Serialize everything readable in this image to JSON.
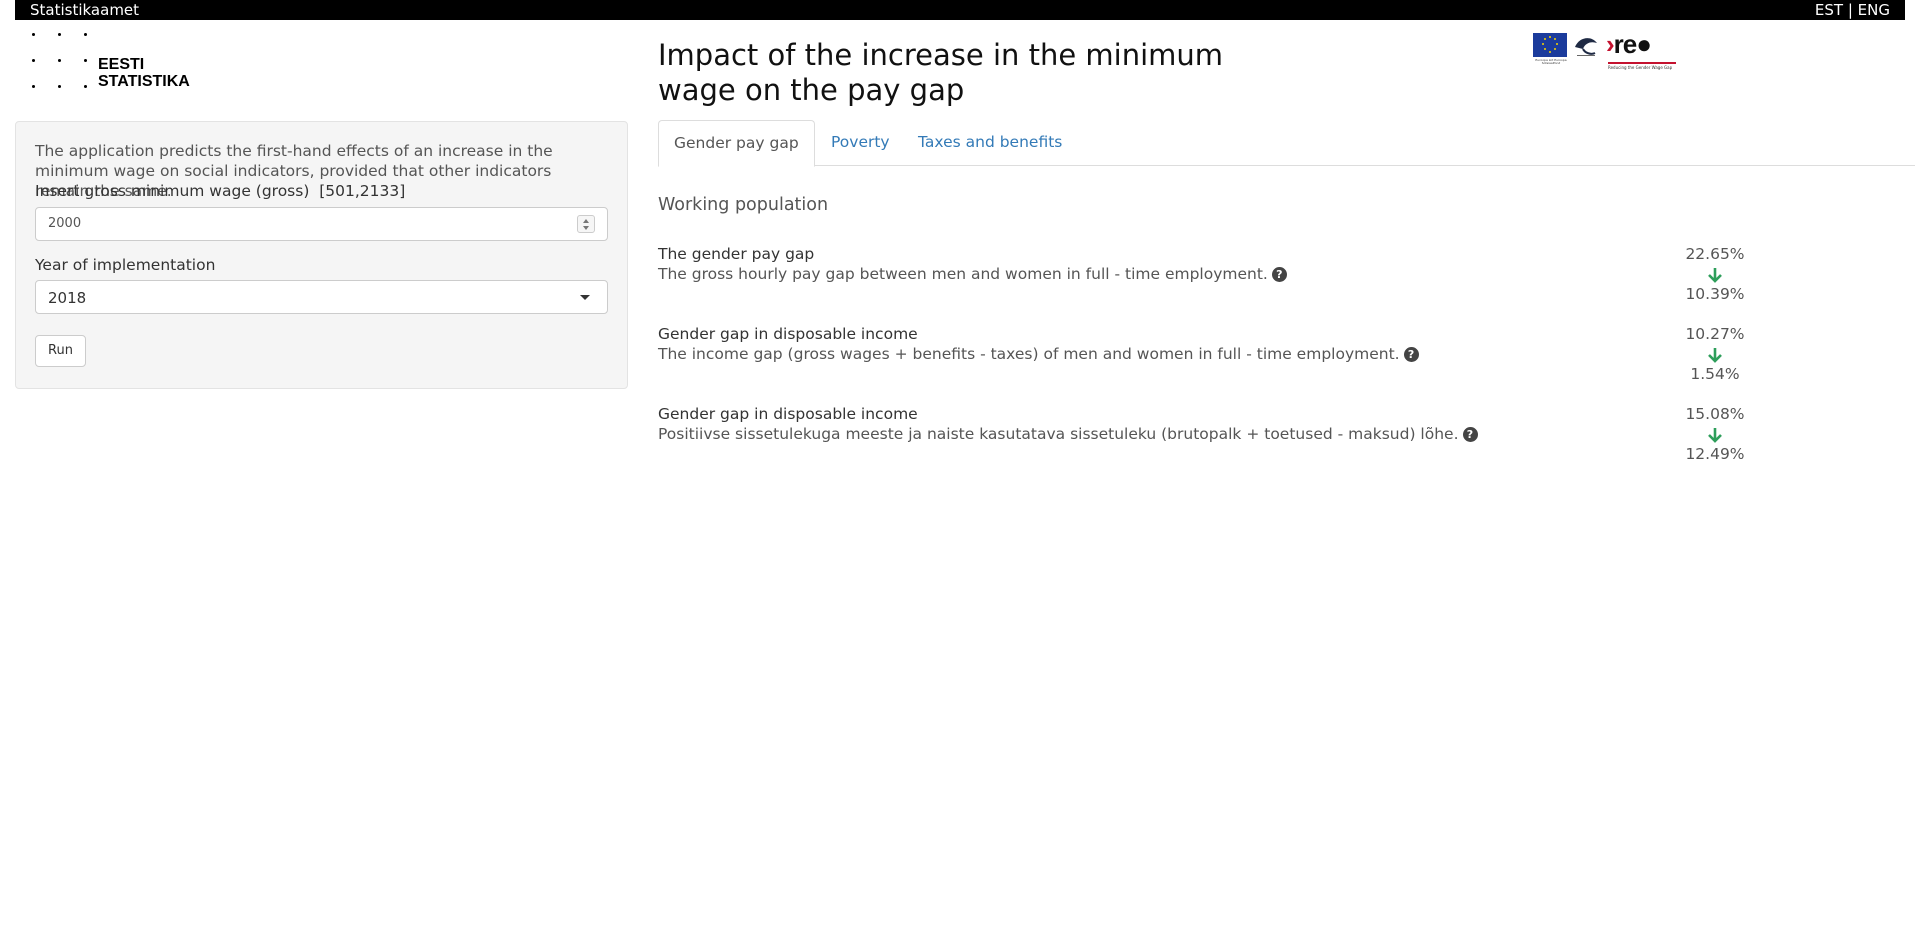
{
  "topbar": {
    "org_name": "Statistikaamet",
    "lang_est": "EST",
    "lang_sep": "|",
    "lang_eng": "ENG"
  },
  "logo": {
    "line1": "EESTI",
    "line2": "STATISTIKA"
  },
  "sidebar": {
    "description": "The application predicts the first-hand effects of an increase in the minimum wage on social indicators, provided that other indicators remain the same.",
    "wage_label": "Insert gross minimum wage (gross)  [501,2133]",
    "wage_value": "2000",
    "year_label": "Year of implementation",
    "year_value": "2018",
    "run_label": "Run"
  },
  "main": {
    "title": "Impact of the increase in the minimum wage on the pay gap",
    "partner_logos": {
      "eu_text": "Euroopa Liit Euroopa Sotsiaalfond",
      "reke_mark": "re",
      "reke_caption": "Reducing the Gender Wage Gap"
    },
    "tabs": [
      {
        "label": "Gender pay gap"
      },
      {
        "label": "Poverty"
      },
      {
        "label": "Taxes and benefits"
      }
    ],
    "section_title": "Working population",
    "indicators": [
      {
        "title": "The gender pay gap",
        "description": "The gross hourly pay gap between men and women in full - time employment.",
        "before": "22.65%",
        "after": "10.39%",
        "trend": "down"
      },
      {
        "title": "Gender gap in disposable income",
        "description": "The income gap (gross wages + benefits - taxes) of men and women in full - time employment.",
        "before": "10.27%",
        "after": "1.54%",
        "trend": "down"
      },
      {
        "title": "Gender gap in disposable income",
        "description": "Positiivse sissetulekuga meeste ja naiste kasutatava sissetuleku (brutopalk + toetused - maksud) lõhe.",
        "before": "15.08%",
        "after": "12.49%",
        "trend": "down"
      }
    ],
    "help_glyph": "?",
    "arrow_color": "#2e9e5b"
  }
}
